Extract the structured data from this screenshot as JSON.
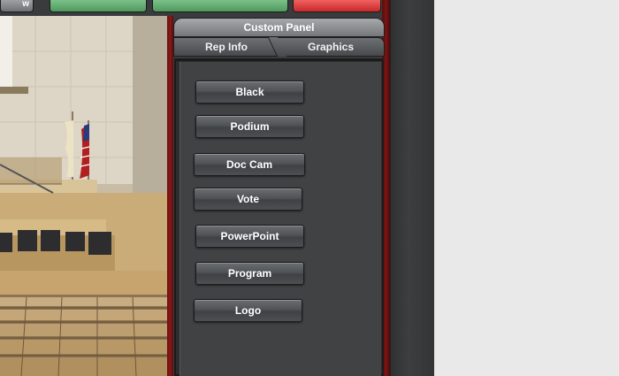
{
  "top_bar": {
    "left_button_label": "w"
  },
  "camera": {
    "description_icon": "camera-feed"
  },
  "panel": {
    "title": "Custom Panel",
    "tabs": [
      {
        "label": "Rep Info"
      },
      {
        "label": "Graphics"
      }
    ],
    "buttons": [
      {
        "label": "Black"
      },
      {
        "label": "Podium"
      },
      {
        "label": "Doc Cam"
      },
      {
        "label": "Vote"
      },
      {
        "label": "PowerPoint"
      },
      {
        "label": "Program"
      },
      {
        "label": "Logo"
      }
    ]
  },
  "colors": {
    "accent_green": "#5fae6e",
    "accent_red": "#e03a3a",
    "frame_dark": "#3a3b3d",
    "border_red": "#7a1414"
  }
}
